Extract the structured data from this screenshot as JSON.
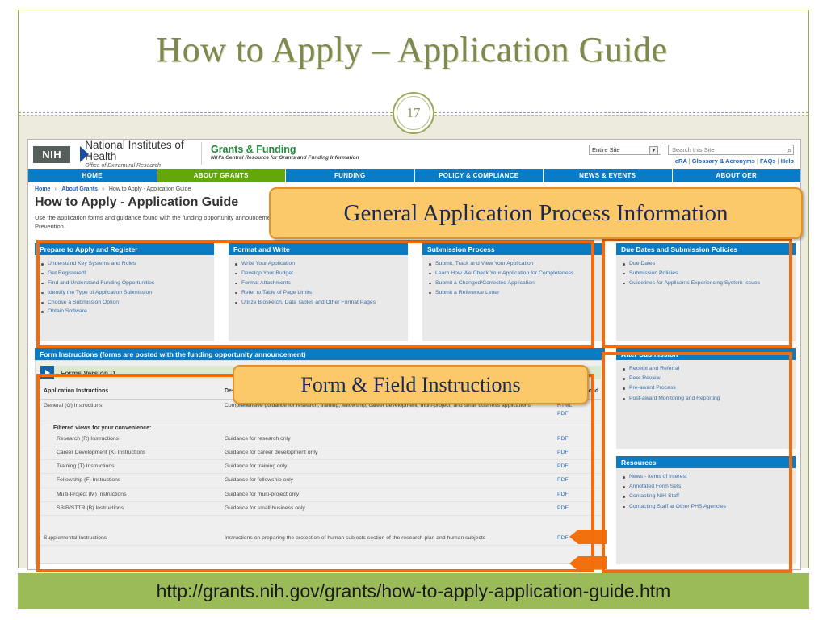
{
  "slide": {
    "title": "How to Apply – Application Guide",
    "page_number": "17",
    "footer_url": "http://grants.nih.gov/grants/how-to-apply-application-guide.htm",
    "accent_green": "#7c8a4c",
    "band_green": "#9bbb59",
    "annotation_orange": "#f26c0d",
    "callout_fill": "#fbc96a"
  },
  "callouts": [
    {
      "label": "General Application Process Information"
    },
    {
      "label": "Form & Field Instructions"
    }
  ],
  "site": {
    "logo": {
      "badge": "NIH",
      "org_line1": "National Institutes of Health",
      "org_line2": "Office of Extramural Research",
      "section_line1": "Grants & Funding",
      "section_line2": "NIH's Central Resource for Grants and Funding Information"
    },
    "search": {
      "scope_value": "Entire Site",
      "scope_options": [
        "Entire Site"
      ],
      "placeholder": "Search this Site",
      "value": "",
      "icon": "search-icon"
    },
    "utility_links": [
      "eRA",
      "Glossary & Acronyms",
      "FAQs",
      "Help"
    ],
    "utility_separator": "|",
    "nav": [
      {
        "label": "HOME",
        "active": false
      },
      {
        "label": "ABOUT GRANTS",
        "active": true
      },
      {
        "label": "FUNDING",
        "active": false
      },
      {
        "label": "POLICY & COMPLIANCE",
        "active": false
      },
      {
        "label": "NEWS & EVENTS",
        "active": false
      },
      {
        "label": "ABOUT OER",
        "active": false
      }
    ],
    "breadcrumb": {
      "items": [
        "Home",
        "About Grants",
        "How to Apply - Application Guide"
      ],
      "separator": "»"
    },
    "page_heading": "How to Apply - Application Guide",
    "page_intro": "Use the application forms and guidance found with the funding opportunity announcement to apply. This guide applies to applications to NIH and other PHS agencies, such as the Centers for Disease Control and Prevention.",
    "cards": [
      {
        "title": "Prepare to Apply and Register",
        "items": [
          "Understand Key Systems and Roles",
          "Get Registered!",
          "Find and Understand Funding Opportunities",
          "Identify the Type of Application Submission",
          "Choose a Submission Option",
          "Obtain Software"
        ]
      },
      {
        "title": "Format and Write",
        "items": [
          "Write Your Application",
          "Develop Your Budget",
          "Format Attachments",
          "Refer to Table of Page Limits",
          "Utilize Biosketch, Data Tables and Other Format Pages"
        ]
      },
      {
        "title": "Submission Process",
        "items": [
          "Submit, Track and View Your Application",
          "Learn How We Check Your Application for Completeness",
          "Submit a Changed/Corrected Application",
          "Submit a Reference Letter"
        ]
      },
      {
        "title": "Due Dates and Submission Policies",
        "items": [
          "Due Dates",
          "Submission Policies",
          "Guidelines for Applicants Experiencing System Issues"
        ]
      }
    ],
    "form_instructions": {
      "band_title": "Form Instructions (forms are posted with the funding opportunity announcement)",
      "version_row": "Forms Version D",
      "columns": [
        "Application Instructions",
        "Description",
        "View/Download"
      ],
      "rows": [
        {
          "name": "General (G) Instructions",
          "description": "Comprehensive guidance for research, training, fellowship, career development, multi-project, and small business applications",
          "links": [
            "HTML",
            "PDF"
          ],
          "indent": false
        }
      ],
      "filtered_note": "Filtered views for your convenience:",
      "filtered_rows": [
        {
          "name": "Research (R) Instructions",
          "description": "Guidance for research only",
          "links": [
            "PDF"
          ]
        },
        {
          "name": "Career Development (K) Instructions",
          "description": "Guidance for career development only",
          "links": [
            "PDF"
          ]
        },
        {
          "name": "Training (T) Instructions",
          "description": "Guidance for training only",
          "links": [
            "PDF"
          ]
        },
        {
          "name": "Fellowship (F) Instructions",
          "description": "Guidance for fellowship only",
          "links": [
            "PDF"
          ]
        },
        {
          "name": "Multi-Project (M) Instructions",
          "description": "Guidance for multi-project only",
          "links": [
            "PDF"
          ]
        },
        {
          "name": "SBIR/STTR (B) Instructions",
          "description": "Guidance for small business only",
          "links": [
            "PDF"
          ]
        }
      ],
      "supplemental_row": {
        "name": "Supplemental Instructions",
        "description": "Instructions on preparing the protection of human subjects section of the research plan and human subjects",
        "links": [
          "PDF"
        ]
      }
    },
    "side_boxes": [
      {
        "title": "After Submission",
        "items": [
          "Receipt and Referral",
          "Peer Review",
          "Pre-award Process",
          "Post-award Monitoring and Reporting"
        ]
      },
      {
        "title": "Resources",
        "items": [
          "News - Items of Interest",
          "Annotated Form Sets",
          "Contacting NIH Staff",
          "Contacting Staff at Other PHS Agencies"
        ]
      }
    ]
  }
}
